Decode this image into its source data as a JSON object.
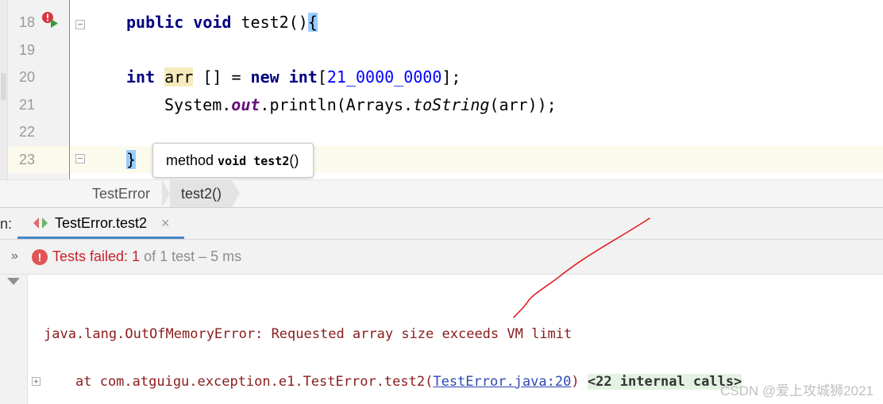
{
  "editor": {
    "line_numbers": [
      "18",
      "19",
      "20",
      "21",
      "22",
      "23"
    ],
    "line18": {
      "kw1": "public",
      "kw2": "void",
      "name": " test2()",
      "brace": "{"
    },
    "line20": {
      "kw1": "int",
      "var": "arr",
      "mid": " [] = ",
      "kw2": "new",
      "kw3": "int",
      "open": "[",
      "num": "21_0000_0000",
      "close": "];"
    },
    "line21": {
      "p1": "System.",
      "field": "out",
      "p2": ".println(Arrays.",
      "method": "toString",
      "p3": "(arr));"
    },
    "line23": {
      "brace": "}"
    }
  },
  "tooltip": {
    "prefix": "method ",
    "bold": "void test2",
    "suffix": "()"
  },
  "breadcrumb": {
    "items": [
      "TestError",
      "test2()"
    ]
  },
  "run_panel": {
    "label": "n:",
    "tab_title": "TestError.test2",
    "tab_close": "×",
    "expand_chevron": "»",
    "status": {
      "icon": "!",
      "failed": "Tests failed: ",
      "count": "1",
      "of": " of 1 test – 5 ms"
    }
  },
  "console": {
    "error_line": "java.lang.OutOfMemoryError: Requested array size exceeds VM limit",
    "trace_prefix": "at com.atguigu.exception.e1.TestError.test2(",
    "trace_link": "TestError.java:20",
    "trace_suffix": ")",
    "internal": "<22 internal calls>"
  },
  "watermark": "CSDN @爱上攻城狮2021",
  "colors": {
    "keyword": "#000080",
    "number": "#0000ff",
    "field": "#660e7a",
    "error": "#c7222d",
    "tab_underline": "#4a86c8",
    "annotation_stroke": "#e02020"
  },
  "icons": [
    "run-test-failed-icon",
    "fold-icon",
    "test-tab-icon",
    "error-icon",
    "expand-icon"
  ]
}
